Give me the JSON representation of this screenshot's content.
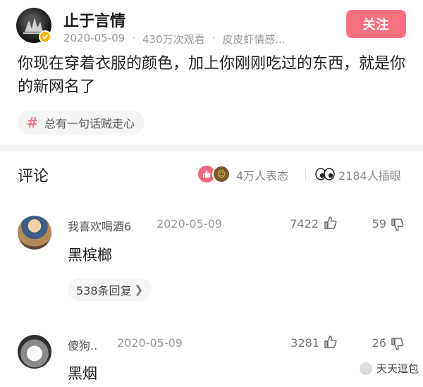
{
  "post": {
    "author_name": "止于言情",
    "date": "2020-05-09",
    "views": "430万次观看",
    "source": "皮皮虾情感...",
    "follow_label": "关注",
    "text": "你现在穿着衣服的颜色，加上你刚刚吃过的东西，就是你的新网名了",
    "topic_tag": "总有一句话贼走心"
  },
  "comments_header": {
    "title": "评论",
    "reaction_count": "4万人表态",
    "eyes_count": "2184人插眼"
  },
  "comments": [
    {
      "name": "我喜欢喝酒6",
      "date": "2020-05-09",
      "likes": "7422",
      "dislikes": "59",
      "text": "黑槟榔",
      "replies": "538条回复"
    },
    {
      "name": "傻狗..",
      "date": "2020-05-09",
      "likes": "3281",
      "dislikes": "26",
      "text": "黑烟"
    }
  ],
  "watermark": "天天逗包",
  "colors": {
    "accent": "#f7717f",
    "tag_hash": "#f4788a",
    "verified": "#f5b400"
  }
}
